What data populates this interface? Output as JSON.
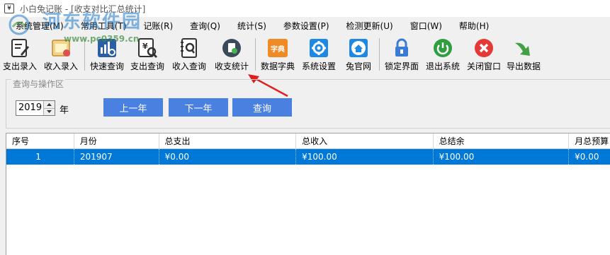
{
  "window": {
    "icon": "¥",
    "title": "小白兔记账 - [收支对比汇总统计]"
  },
  "watermark": {
    "text": "河东软件园",
    "url": "www.pc0359.cn"
  },
  "menu": {
    "items": [
      {
        "label": "系统管理(M)"
      },
      {
        "label": "常用工具(T)"
      },
      {
        "label": "记账(R)"
      },
      {
        "label": "查询(Q)"
      },
      {
        "label": "统计(S)"
      },
      {
        "label": "参数设置(P)"
      },
      {
        "label": "检测更新(U)"
      },
      {
        "label": "窗口(W)"
      },
      {
        "label": "帮助(H)"
      }
    ]
  },
  "toolbar": {
    "items": [
      {
        "label": "支出录入",
        "icon": "expense-entry-icon"
      },
      {
        "label": "收入录入",
        "icon": "income-entry-icon"
      },
      {
        "label": "快速查询",
        "icon": "quick-query-icon"
      },
      {
        "label": "支出查询",
        "icon": "expense-query-icon"
      },
      {
        "label": "收入查询",
        "icon": "income-query-icon"
      },
      {
        "label": "收支统计",
        "icon": "statistics-icon"
      },
      {
        "label": "数据字典",
        "icon": "dictionary-icon",
        "badge": "字典"
      },
      {
        "label": "系统设置",
        "icon": "settings-gear-icon"
      },
      {
        "label": "兔官网",
        "icon": "home-icon"
      },
      {
        "label": "锁定界面",
        "icon": "lock-icon"
      },
      {
        "label": "退出系统",
        "icon": "power-icon"
      },
      {
        "label": "关闭窗口",
        "icon": "close-icon"
      },
      {
        "label": "导出数据",
        "icon": "export-arrow-icon"
      }
    ]
  },
  "query": {
    "legend": "查询与操作区",
    "year": "2019",
    "year_suffix": "年",
    "prev_year": "上一年",
    "next_year": "下一年",
    "search": "查询"
  },
  "table": {
    "columns": [
      "序号",
      "月份",
      "总支出",
      "总收入",
      "总结余",
      "月总预算"
    ],
    "rows": [
      [
        "1",
        "201907",
        "¥0.00",
        "¥100.00",
        "¥100.00",
        "¥0.00"
      ]
    ]
  },
  "colors": {
    "accent_button": "#4a80e0",
    "selection": "#0078d7",
    "arrow": "#e02020"
  }
}
